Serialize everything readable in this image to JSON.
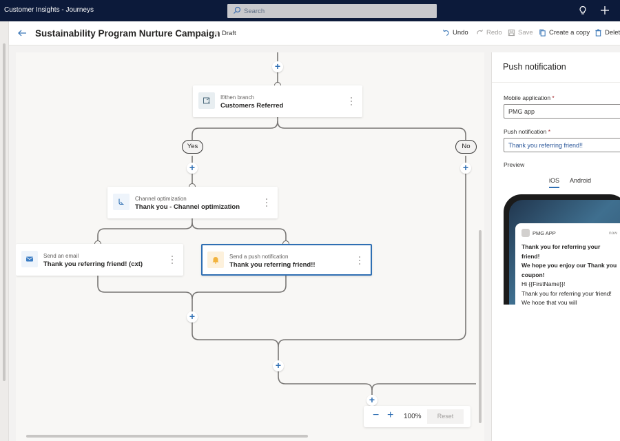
{
  "app": {
    "title": "Customer Insights - Journeys"
  },
  "search": {
    "placeholder": "Search"
  },
  "header": {
    "title": "Sustainability Program Nurture Campaign",
    "status": "Draft",
    "commands": [
      {
        "label": "Undo",
        "icon": "undo-icon",
        "enabled": true
      },
      {
        "label": "Redo",
        "icon": "redo-icon",
        "enabled": false
      },
      {
        "label": "Save",
        "icon": "save-icon",
        "enabled": false
      },
      {
        "label": "Create a copy",
        "icon": "copy-icon",
        "enabled": true
      },
      {
        "label": "Delete",
        "icon": "delete-icon",
        "enabled": true
      }
    ]
  },
  "canvas": {
    "nodes": {
      "branch": {
        "type": "If/then branch",
        "name": "Customers Referred"
      },
      "channel": {
        "type": "Channel optimization",
        "name": "Thank you - Channel optimization"
      },
      "email": {
        "type": "Send an email",
        "name": "Thank you referring friend! (cxt)"
      },
      "push": {
        "type": "Send a push notification",
        "name": "Thank you referring friend!!"
      }
    },
    "branches": {
      "yes": "Yes",
      "no": "No"
    },
    "zoom": {
      "value": "100%",
      "reset": "Reset",
      "minus": "−",
      "plus": "+"
    }
  },
  "panel": {
    "title": "Push notification",
    "mobile_app": {
      "label": "Mobile application",
      "required": "*",
      "value": "PMG app"
    },
    "push_notification": {
      "label": "Push notification",
      "required": "*",
      "value": "Thank you referring friend!!"
    },
    "preview": {
      "label": "Preview",
      "tabs": [
        {
          "label": "iOS",
          "active": true
        },
        {
          "label": "Android",
          "active": false
        }
      ],
      "notification": {
        "app_name": "PMG APP",
        "time": "now",
        "title": "Thank you for referring your friend!",
        "subtitle": "We hope you enjoy our Thank you coupon!",
        "greeting": "Hi {{FirstName}}!",
        "message": "Thank you for referring your friend! We hope that you will"
      }
    }
  },
  "colors": {
    "topbar": "#0c1a3a",
    "accent": "#2f6fb3",
    "push_icon_bg": "#fdf1dc",
    "email_icon_bg": "#eef4fb"
  }
}
